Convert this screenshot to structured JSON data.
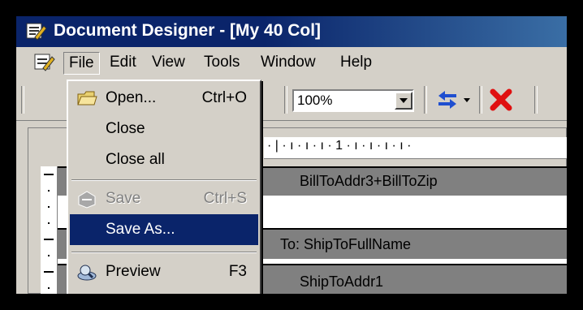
{
  "window": {
    "title": "Document Designer - [My 40 Col]"
  },
  "menubar": {
    "items": [
      "File",
      "Edit",
      "View",
      "Tools",
      "Window",
      "Help"
    ]
  },
  "toolbar": {
    "zoom": "100%"
  },
  "ruler": {
    "text": "· | · ı · ı · ı · 1 · ı · ı · ı · ı ·"
  },
  "canvas": {
    "fields": [
      "BillToAddr3+BillToZip",
      "To:  ShipToFullName",
      "ShipToAddr1"
    ]
  },
  "file_menu": {
    "items": [
      {
        "label": "Open...",
        "shortcut": "Ctrl+O",
        "icon": "open-folder-icon"
      },
      {
        "label": "Close",
        "shortcut": ""
      },
      {
        "label": "Close all",
        "shortcut": ""
      },
      {
        "label": "Save",
        "shortcut": "Ctrl+S",
        "icon": "save-icon",
        "disabled": true
      },
      {
        "label": "Save As...",
        "shortcut": "",
        "highlighted": true
      },
      {
        "label": "Preview",
        "shortcut": "F3",
        "icon": "preview-icon"
      }
    ]
  },
  "colors": {
    "title_bar": "#0a246a",
    "menu_highlight": "#0a246a",
    "chrome": "#d4d0c8"
  }
}
